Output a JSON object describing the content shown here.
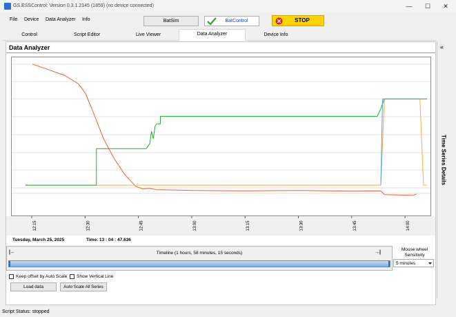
{
  "window": {
    "title": "GS.ESSControl: Version 0.3.1.2145 (1859) (no device connected)",
    "controls": {
      "minimize": "—",
      "maximize": "☐",
      "close": "✕"
    }
  },
  "menu": [
    "File",
    "Device",
    "Data Analyzer",
    "Info"
  ],
  "toolbar": {
    "batsim_label": "BatSim",
    "batcontrol_label": "BatControl",
    "stop_label": "STOP"
  },
  "tabs": [
    {
      "label": "Control",
      "active": false
    },
    {
      "label": "Script Editor",
      "active": false
    },
    {
      "label": "Live Viewer",
      "active": false
    },
    {
      "label": "Data Analyzer",
      "active": true
    },
    {
      "label": "Device Info",
      "active": false
    }
  ],
  "panel": {
    "title": "Data Analyzer"
  },
  "side_panel": {
    "collapse_glyph": "«",
    "label": "Time Series Details"
  },
  "chart_data": {
    "type": "line",
    "xlabel": "",
    "ylabel": "",
    "x_ticks": [
      "12:15",
      "12:30",
      "12:45",
      "13:00",
      "13:15",
      "13:30",
      "13:45",
      "14:00"
    ],
    "y_tick_labels": [],
    "grid": true,
    "series": [
      {
        "color": "#e8603c",
        "points": [
          [
            "12:15",
            52
          ],
          [
            "12:20",
            49.5
          ],
          [
            "12:24",
            47.5
          ],
          [
            "12:28",
            44
          ],
          [
            "12:30",
            40
          ],
          [
            "12:32",
            33
          ],
          [
            "12:35",
            22
          ],
          [
            "12:38",
            14
          ],
          [
            "12:41",
            7.5
          ],
          [
            "12:43",
            4.5
          ],
          [
            "12:44",
            2.9
          ],
          [
            "12:46",
            1.8
          ],
          [
            "12:48",
            2.0
          ],
          [
            "12:50",
            1.5
          ],
          [
            "13:00",
            1.2
          ],
          [
            "13:15",
            1.0
          ],
          [
            "13:30",
            1.2
          ],
          [
            "13:45",
            0.9
          ],
          [
            "13:53",
            1.0
          ],
          [
            "13:54",
            -0.5
          ],
          [
            "14:02",
            -0.8
          ],
          [
            "14:03",
            -0.3
          ]
        ]
      },
      {
        "color": "#ffa64d",
        "points": [
          [
            "12:13",
            3.3
          ],
          [
            "13:53",
            3.3
          ],
          [
            "13:54",
            38
          ],
          [
            "14:00",
            38
          ],
          [
            "14:04",
            38
          ],
          [
            "14:05",
            3.3
          ],
          [
            "14:06",
            3.3
          ]
        ]
      },
      {
        "color": "#22aa3a",
        "points": [
          [
            "12:13",
            3.3
          ],
          [
            "12:33",
            3.3
          ],
          [
            "12:33",
            18
          ],
          [
            "12:47",
            18
          ],
          [
            "12:48",
            20
          ],
          [
            "12:48.5",
            25
          ],
          [
            "12:49",
            22
          ],
          [
            "12:49.5",
            27
          ],
          [
            "12:50",
            28
          ],
          [
            "12:51",
            28
          ],
          [
            "12:51",
            31
          ],
          [
            "13:52",
            31
          ],
          [
            "13:53",
            34
          ],
          [
            "13:54",
            38
          ],
          [
            "14:06",
            38
          ]
        ]
      },
      {
        "color": "#4aa6d8",
        "points": [
          [
            "13:53",
            3.3
          ],
          [
            "13:53.5",
            38
          ],
          [
            "14:05",
            38
          ]
        ]
      }
    ]
  },
  "date_label": "Tuesday, March 25, 2025",
  "time_label": "Time: 13 : 04 : 47.636",
  "timeline": {
    "label": "Timeline (1 hours, 58 minutes, 15 seconds)",
    "left_arrow": "|←",
    "right_arrow": "→|"
  },
  "sensitivity": {
    "label": "Mouse wheel Sensitivity",
    "value": "5 minutes"
  },
  "options": {
    "keep_offset_label": "Keep offset by Auto Scale",
    "show_vertical_line_label": "Show Vertical Line"
  },
  "buttons": {
    "load_data": "Load data",
    "auto_scale": "Auto Scale All Series"
  },
  "status_bar": {
    "text": "Script Status: stopped"
  }
}
